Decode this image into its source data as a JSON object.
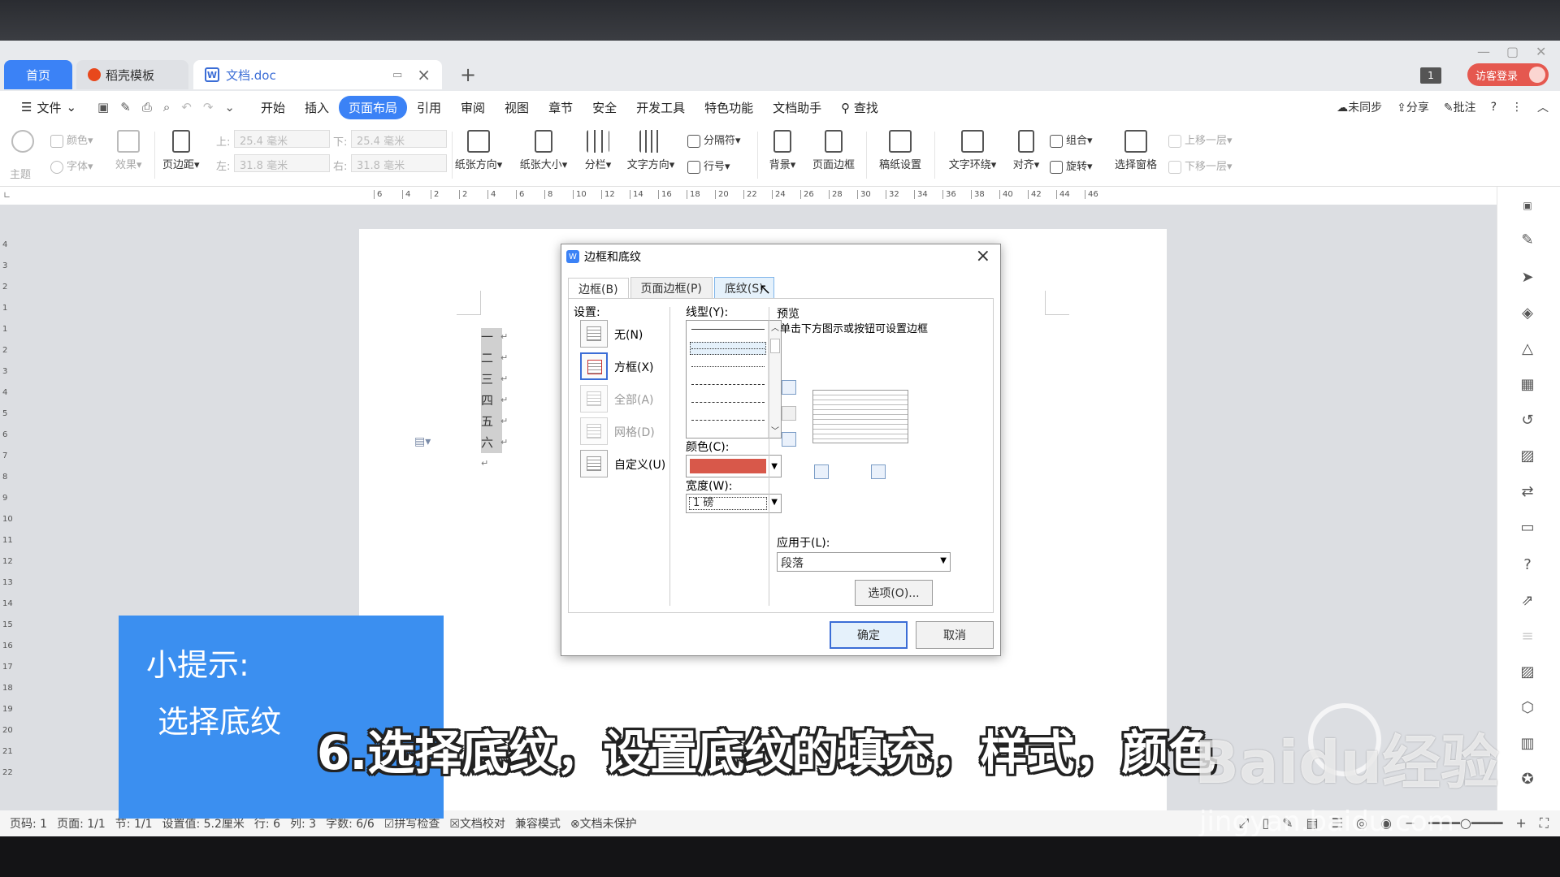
{
  "tabs": {
    "home": "首页",
    "template": "稻壳模板",
    "doc": "文档.doc",
    "plus": "+",
    "count": "1",
    "login": "访客登录"
  },
  "menu": {
    "file": "文件",
    "items": [
      "开始",
      "插入",
      "页面布局",
      "引用",
      "审阅",
      "视图",
      "章节",
      "安全",
      "开发工具",
      "特色功能",
      "文档助手"
    ],
    "active": "页面布局",
    "search": "查找",
    "right": [
      "未同步",
      "分享",
      "批注"
    ]
  },
  "ribbon": {
    "theme": "主题",
    "color": "颜色",
    "font": "字体",
    "effect": "效果",
    "margin": "页边距",
    "top_label": "上:",
    "top_val": "25.4 毫米",
    "bottom_label": "下:",
    "bottom_val": "25.4 毫米",
    "left_label": "左:",
    "left_val": "31.8 毫米",
    "right_label": "右:",
    "right_val": "31.8 毫米",
    "orientation": "纸张方向",
    "size": "纸张大小",
    "columns": "分栏",
    "text_dir": "文字方向",
    "breaks": "分隔符",
    "line_num": "行号",
    "background": "背景",
    "page_border": "页面边框",
    "grid_paper": "稿纸设置",
    "wrap": "文字环绕",
    "align": "对齐",
    "group": "组合",
    "rotate": "旋转",
    "select_pane": "选择窗格",
    "bring_forward": "上移一层",
    "send_backward": "下移一层"
  },
  "ruler": {
    "h_ticks": [
      "6",
      "4",
      "2",
      "2",
      "4",
      "6",
      "8",
      "10",
      "12",
      "14",
      "16",
      "18",
      "20",
      "22",
      "24",
      "26",
      "28",
      "30",
      "32",
      "34",
      "36",
      "38",
      "40",
      "42",
      "44",
      "46"
    ],
    "v_ticks": [
      "4",
      "3",
      "2",
      "1",
      "1",
      "2",
      "3",
      "4",
      "5",
      "6",
      "7",
      "8",
      "9",
      "10",
      "11",
      "12",
      "13",
      "14",
      "15",
      "16",
      "17",
      "18",
      "19",
      "20",
      "21",
      "22"
    ]
  },
  "doc": {
    "lines": [
      "一",
      "二",
      "三",
      "四",
      "五",
      "六"
    ]
  },
  "dialog": {
    "title": "边框和底纹",
    "tabs": [
      "边框(B)",
      "页面边框(P)",
      "底纹(S)"
    ],
    "settings_label": "设置:",
    "settings": [
      "无(N)",
      "方框(X)",
      "全部(A)",
      "网格(D)",
      "自定义(U)"
    ],
    "line_style_label": "线型(Y):",
    "color_label": "颜色(C):",
    "color_value": "#d8584a",
    "width_label": "宽度(W):",
    "width_value": "1 磅",
    "preview_label": "预览",
    "preview_hint": "单击下方图示或按钮可设置边框",
    "apply_label": "应用于(L):",
    "apply_value": "段落",
    "options": "选项(O)...",
    "ok": "确定",
    "cancel": "取消"
  },
  "status": [
    "页码: 1",
    "页面: 1/1",
    "节: 1/1",
    "设置值: 5.2厘米",
    "行: 6",
    "列: 3",
    "字数: 6/6",
    "拼写检查",
    "文档校对",
    "兼容模式",
    "文档未保护"
  ],
  "overlay": {
    "tip_title": "小提示:",
    "tip_text": "选择底纹",
    "subtitle": "6.选择底纹，设置底纹的填充，样式，颜色",
    "watermark": "Baidu经验",
    "watermark_url": "jingyan.baidu.com"
  }
}
